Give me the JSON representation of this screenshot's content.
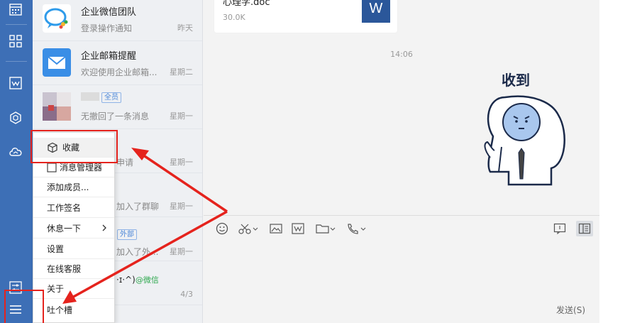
{
  "rail": {
    "icons": [
      "calendar-icon",
      "apps-icon",
      "doc-icon",
      "cube-icon",
      "cloud-icon",
      "sliders-icon",
      "menu-icon"
    ]
  },
  "conversations": [
    {
      "name": "企业微信团队",
      "message": "登录操作通知",
      "time": "昨天"
    },
    {
      "name": "企业邮箱提醒",
      "message": "欢迎使用企业邮箱...",
      "time": "星期二"
    },
    {
      "name": "",
      "tag": "全员",
      "message": "无撤回了一条消息",
      "time": "星期一"
    },
    {
      "name": "",
      "message": "申请",
      "time": "星期一"
    },
    {
      "name": "",
      "message": "加入了群聊",
      "time": "星期一"
    },
    {
      "name": "",
      "tag": "外部",
      "message": "加入了外...",
      "time": "星期一"
    },
    {
      "name": "",
      "emoticon": "·ɪ·^)",
      "wechat": "@微信",
      "message": "",
      "time": "4/3"
    }
  ],
  "menu": {
    "items": [
      {
        "label": "收藏",
        "highlight": true
      },
      {
        "label": "消息管理器"
      },
      {
        "label": "添加成员..."
      },
      {
        "label": "工作签名"
      },
      {
        "label": "休息一下",
        "submenu": true
      },
      {
        "label": "设置"
      },
      {
        "label": "在线客服"
      },
      {
        "label": "关于"
      },
      {
        "label": "吐个槽"
      }
    ]
  },
  "chat": {
    "file": {
      "name": "心理学.doc",
      "size": "30.0K",
      "icon": "W"
    },
    "timestamp": "14:06",
    "sticker_text": "收到",
    "send_label": "发送(S)"
  },
  "colors": {
    "rail": "#3d6fb6",
    "annotation": "#e5231d",
    "word": "#2b579a"
  }
}
